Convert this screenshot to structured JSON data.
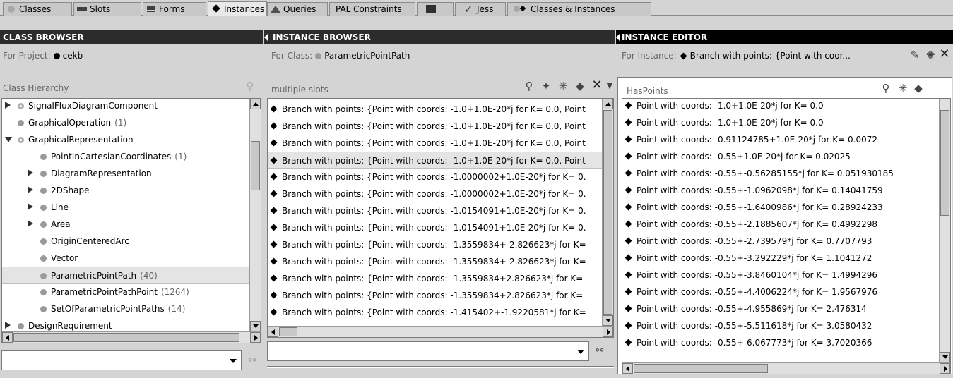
{
  "tabs": [
    {
      "label": "Classes",
      "icon": "circle-icon"
    },
    {
      "label": "Slots",
      "icon": "slots-icon"
    },
    {
      "label": "Forms",
      "icon": "forms-icon"
    },
    {
      "label": "Instances",
      "icon": "diamond-icon"
    },
    {
      "label": "Queries",
      "icon": "mountain-icon"
    },
    {
      "label": "PAL Constraints",
      "icon": ""
    },
    {
      "label": "",
      "icon": "square-icon"
    },
    {
      "label": "Jess",
      "icon": "check-icon"
    },
    {
      "label": "Classes & Instances",
      "icon": "circle-diamond-icon"
    }
  ],
  "active_tab": "Instances",
  "class_browser": {
    "title": "CLASS BROWSER",
    "for_label": "For Project:",
    "project": "cekb",
    "hierarchy_label": "Class Hierarchy",
    "items": [
      {
        "label": "SignalFluxDiagramComponent",
        "count": "",
        "expand": "right",
        "ring": true
      },
      {
        "label": "GraphicalOperation",
        "count": "(1)",
        "expand": "",
        "ring": false
      },
      {
        "label": "GraphicalRepresentation",
        "count": "",
        "expand": "down",
        "ring": true
      },
      {
        "label": "PointInCartesianCoordinates",
        "count": "(1)",
        "expand": "",
        "ring": false
      },
      {
        "label": "DiagramRepresentation",
        "count": "",
        "expand": "right",
        "ring": false
      },
      {
        "label": "2DShape",
        "count": "",
        "expand": "right",
        "ring": false
      },
      {
        "label": "Line",
        "count": "",
        "expand": "right",
        "ring": false
      },
      {
        "label": "Area",
        "count": "",
        "expand": "right",
        "ring": false
      },
      {
        "label": "OriginCenteredArc",
        "count": "",
        "expand": "",
        "ring": false
      },
      {
        "label": "Vector",
        "count": "",
        "expand": "",
        "ring": false
      },
      {
        "label": "ParametricPointPath",
        "count": "(40)",
        "expand": "",
        "ring": false,
        "selected": true
      },
      {
        "label": "ParametricPointPathPoint",
        "count": "(1264)",
        "expand": "",
        "ring": false
      },
      {
        "label": "SetOfParametricPointPaths",
        "count": "(14)",
        "expand": "",
        "ring": false
      },
      {
        "label": "DesignRequirement",
        "count": "",
        "expand": "right",
        "ring": false
      }
    ]
  },
  "instance_browser": {
    "title": "INSTANCE BROWSER",
    "for_label": "For Class:",
    "class_name": "ParametricPointPath",
    "slots_label": "multiple slots",
    "items": [
      "Branch with points:  {Point with coords: -1.0+1.0E-20*j for K= 0.0, Point",
      "Branch with points:  {Point with coords: -1.0+1.0E-20*j for K= 0.0, Point",
      "Branch with points:  {Point with coords: -1.0+1.0E-20*j for K= 0.0, Point",
      "Branch with points:  {Point with coords: -1.0+1.0E-20*j for K= 0.0, Point",
      "Branch with points:  {Point with coords: -1.0000002+1.0E-20*j for K= 0.",
      "Branch with points:  {Point with coords: -1.0000002+1.0E-20*j for K= 0.",
      "Branch with points:  {Point with coords: -1.0154091+1.0E-20*j for K= 0.",
      "Branch with points:  {Point with coords: -1.0154091+1.0E-20*j for K= 0.",
      "Branch with points:  {Point with coords: -1.3559834+-2.826623*j for K=",
      "Branch with points:  {Point with coords: -1.3559834+-2.826623*j for K=",
      "Branch with points:  {Point with coords: -1.3559834+2.826623*j for K=",
      "Branch with points:  {Point with coords: -1.3559834+2.826623*j for K=",
      "Branch with points:  {Point with coords: -1.415402+-1.9220581*j for K="
    ],
    "selected_index": 3
  },
  "instance_editor": {
    "title": "INSTANCE EDITOR",
    "for_label": "For Instance:",
    "instance_name": "Branch with points:  {Point with coor...",
    "slot_label": "HasPoints",
    "items": [
      "Point with coords: -1.0+1.0E-20*j for K= 0.0",
      "Point with coords: -1.0+1.0E-20*j for K= 0.0",
      "Point with coords: -0.91124785+1.0E-20*j for K= 0.0072",
      "Point with coords: -0.55+1.0E-20*j for K= 0.02025",
      "Point with coords: -0.55+-0.56285155*j for K= 0.051930185",
      "Point with coords: -0.55+-1.0962098*j for K= 0.14041759",
      "Point with coords: -0.55+-1.6400986*j for K= 0.28924233",
      "Point with coords: -0.55+-2.1885607*j for K= 0.4992298",
      "Point with coords: -0.55+-2.739579*j for K= 0.7707793",
      "Point with coords: -0.55+-3.292229*j for K= 1.1041272",
      "Point with coords: -0.55+-3.8460104*j for K= 1.4994296",
      "Point with coords: -0.55+-4.4006224*j for K= 1.9567976",
      "Point with coords: -0.55+-4.955869*j for K= 2.476314",
      "Point with coords: -0.55+-5.511618*j for K= 3.0580432",
      "Point with coords: -0.55+-6.067773*j for K= 3.7020366"
    ]
  },
  "icons": {
    "search": "search-icon",
    "create": "create-instance-icon",
    "delete": "delete-icon",
    "binoculars": "binoculars-icon"
  }
}
